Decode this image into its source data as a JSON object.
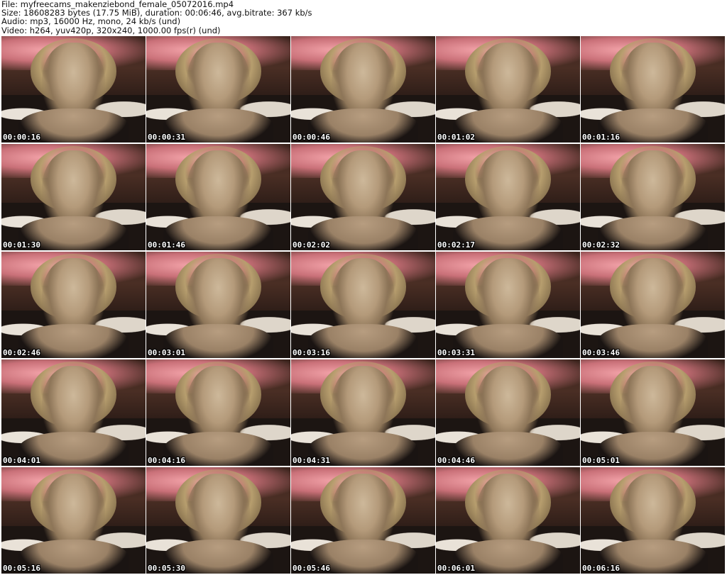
{
  "header": {
    "file_line": "File: myfreecams_makenziebond_female_05072016.mp4",
    "size_line": "Size: 18608283 bytes (17.75 MiB), duration: 00:06:46, avg.bitrate: 367 kb/s",
    "audio_line": "Audio: mp3, 16000 Hz, mono, 24 kb/s (und)",
    "video_line": "Video: h264, yuv420p, 320x240, 1000.00 fps(r) (und)"
  },
  "thumbnails": [
    {
      "timestamp": "00:00:16"
    },
    {
      "timestamp": "00:00:31"
    },
    {
      "timestamp": "00:00:46"
    },
    {
      "timestamp": "00:01:02"
    },
    {
      "timestamp": "00:01:16"
    },
    {
      "timestamp": "00:01:30"
    },
    {
      "timestamp": "00:01:46"
    },
    {
      "timestamp": "00:02:02"
    },
    {
      "timestamp": "00:02:17"
    },
    {
      "timestamp": "00:02:32"
    },
    {
      "timestamp": "00:02:46"
    },
    {
      "timestamp": "00:03:01"
    },
    {
      "timestamp": "00:03:16"
    },
    {
      "timestamp": "00:03:31"
    },
    {
      "timestamp": "00:03:46"
    },
    {
      "timestamp": "00:04:01"
    },
    {
      "timestamp": "00:04:16"
    },
    {
      "timestamp": "00:04:31"
    },
    {
      "timestamp": "00:04:46"
    },
    {
      "timestamp": "00:05:01"
    },
    {
      "timestamp": "00:05:16"
    },
    {
      "timestamp": "00:05:30"
    },
    {
      "timestamp": "00:05:46"
    },
    {
      "timestamp": "00:06:01"
    },
    {
      "timestamp": "00:06:16"
    }
  ]
}
